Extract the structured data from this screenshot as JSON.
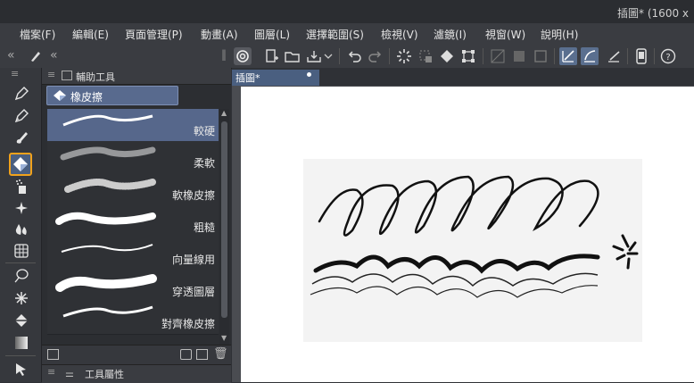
{
  "window": {
    "title": "插圖* (1600 x"
  },
  "menu": [
    "檔案(F)",
    "編輯(E)",
    "頁面管理(P)",
    "動畫(A)",
    "圖層(L)",
    "選擇範圍(S)",
    "檢視(V)",
    "濾鏡(I)",
    "視窗(W)",
    "說明(H)"
  ],
  "subtool_panel": {
    "header": "輔助工具",
    "group_tab": "橡皮擦",
    "items": [
      "較硬",
      "柔軟",
      "軟橡皮擦",
      "粗糙",
      "向量線用",
      "穿透圖層",
      "對齊橡皮擦"
    ]
  },
  "tool_property": {
    "header": "工具屬性"
  },
  "document": {
    "tab": "插圖*"
  }
}
